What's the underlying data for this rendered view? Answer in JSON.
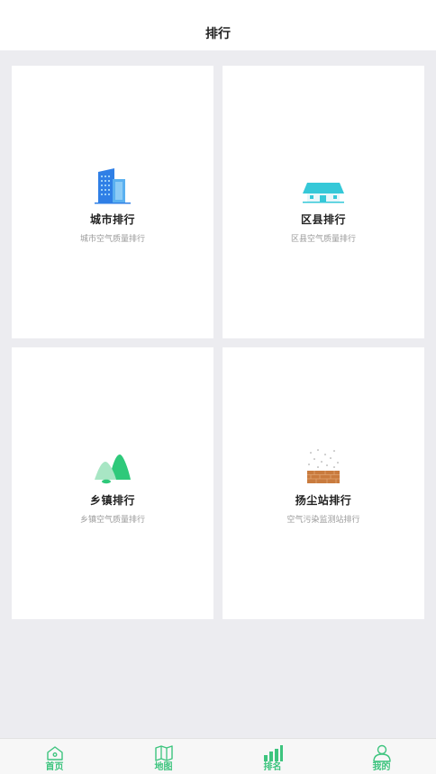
{
  "header": {
    "title": "排行"
  },
  "cards": [
    {
      "title": "城市排行",
      "subtitle": "城市空气质量排行",
      "icon": "city-buildings-icon"
    },
    {
      "title": "区县排行",
      "subtitle": "区县空气质量排行",
      "icon": "house-icon"
    },
    {
      "title": "乡镇排行",
      "subtitle": "乡镇空气质量排行",
      "icon": "hills-icon"
    },
    {
      "title": "扬尘站排行",
      "subtitle": "空气污染监测站排行",
      "icon": "dust-station-icon"
    }
  ],
  "tabbar": {
    "items": [
      {
        "label": "首页",
        "icon": "home-icon"
      },
      {
        "label": "地图",
        "icon": "map-icon"
      },
      {
        "label": "排名",
        "icon": "ranking-bars-icon",
        "active": true
      },
      {
        "label": "我的",
        "icon": "user-icon"
      }
    ]
  },
  "colors": {
    "accent": "#3dc47e",
    "background": "#ececf0",
    "card": "#ffffff"
  }
}
